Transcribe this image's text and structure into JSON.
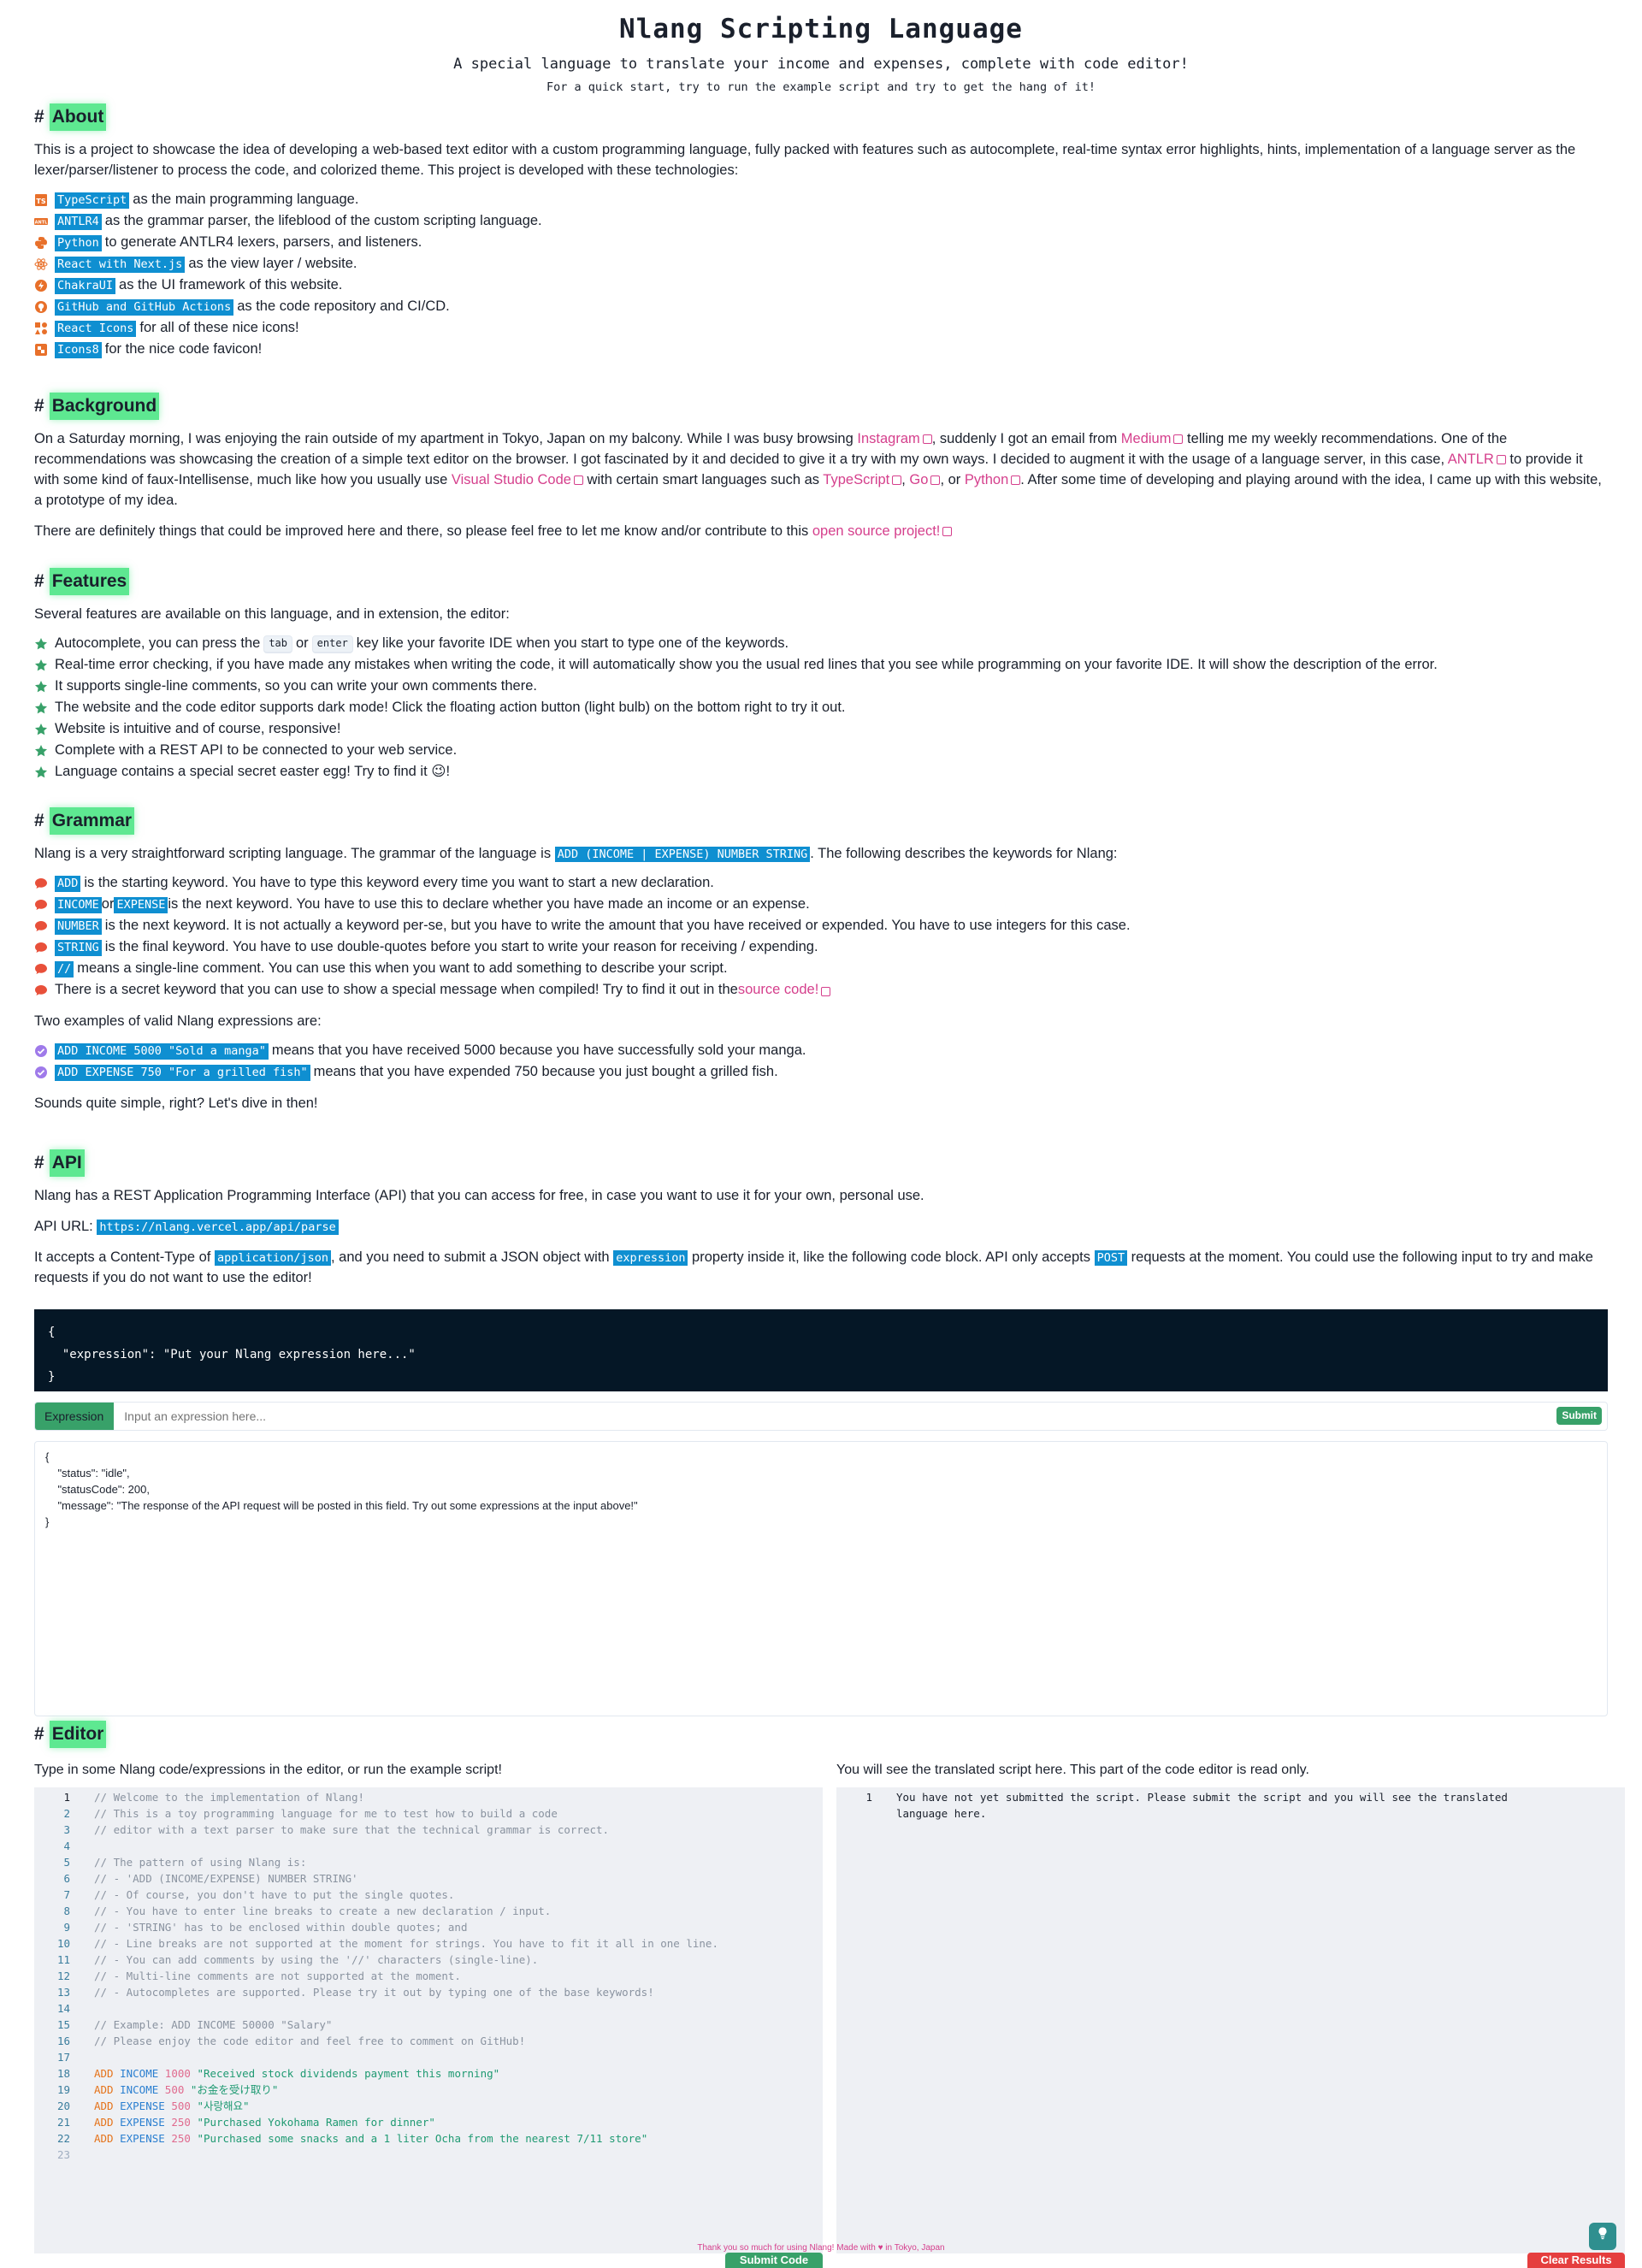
{
  "header": {
    "title": "Nlang Scripting Language",
    "subtitle": "A special language to translate your income and expenses, complete with code editor!",
    "hint": "For a quick start, try to run the example script and try to get the hang of it!"
  },
  "about": {
    "heading": "About",
    "intro": "This is a project to showcase the idea of developing a web-based text editor with a custom programming language, fully packed with features such as autocomplete, real-time syntax error highlights, hints, implementation of a language server as the lexer/parser/listener to process the code, and colorized theme. This project is developed with these technologies:",
    "tech": [
      {
        "icon": "typescript-icon",
        "tag": "TypeScript",
        "text": " as the main programming language."
      },
      {
        "icon": "antlr-icon",
        "tag": "ANTLR4",
        "text": " as the grammar parser, the lifeblood of the custom scripting language."
      },
      {
        "icon": "python-icon",
        "tag": "Python",
        "text": " to generate ANTLR4 lexers, parsers, and listeners."
      },
      {
        "icon": "react-icon",
        "tag": "React with Next.js",
        "text": " as the view layer / website."
      },
      {
        "icon": "chakra-icon",
        "tag": "ChakraUI",
        "text": " as the UI framework of this website."
      },
      {
        "icon": "github-icon",
        "tag": "GitHub and GitHub Actions",
        "text": " as the code repository and CI/CD."
      },
      {
        "icon": "react-icons-icon",
        "tag": "React Icons",
        "text": " for all of these nice icons!"
      },
      {
        "icon": "icons8-icon",
        "tag": "Icons8",
        "text": " for the nice code favicon!"
      }
    ]
  },
  "background": {
    "heading": "Background",
    "p1": {
      "a": "On a Saturday morning, I was enjoying the rain outside of my apartment in Tokyo, Japan on my balcony. While I was busy browsing ",
      "l1": "Instagram",
      "b": ", suddenly I got an email from ",
      "l2": "Medium",
      "c": " telling me my weekly recommendations. One of the recommendations was showcasing the creation of a simple text editor on the browser. I got fascinated by it and decided to give it a try with my own ways. I decided to augment it with the usage of a language server, in this case, ",
      "l3": "ANTLR",
      "d": " to provide it with some kind of faux-Intellisense, much like how you usually use ",
      "l4": "Visual Studio Code",
      "e": " with certain smart languages such as ",
      "l5": "TypeScript",
      "f": ", ",
      "l6": "Go",
      "g": ", or ",
      "l7": "Python",
      "h": ". After some time of developing and playing around with the idea, I came up with this website, a prototype of my idea."
    },
    "p2": "There are definitely things that could be improved here and there, so please feel free to let me know and/or contribute to this ",
    "p2_link": "open source project!"
  },
  "features": {
    "heading": "Features",
    "intro": "Several features are available on this language, and in extension, the editor:",
    "f1_a": "Autocomplete, you can press the ",
    "f1_k1": "tab",
    "f1_b": " or ",
    "f1_k2": "enter",
    "f1_c": " key like your favorite IDE when you start to type one of the keywords.",
    "items": [
      "Real-time error checking, if you have made any mistakes when writing the code, it will automatically show you the usual red lines that you see while programming on your favorite IDE. It will show the description of the error.",
      "It supports single-line comments, so you can write your own comments there.",
      "The website and the code editor supports dark mode! Click the floating action button (light bulb) on the bottom right to try it out.",
      "Website is intuitive and of course, responsive!",
      "Complete with a REST API to be connected to your web service.",
      "Language contains a special secret easter egg! Try to find it 😉!"
    ]
  },
  "grammar": {
    "heading": "Grammar",
    "intro_a": "Nlang is a very straightforward scripting language. The grammar of the language is ",
    "intro_tag": "ADD (INCOME | EXPENSE) NUMBER STRING",
    "intro_b": ". The following describes the keywords for Nlang:",
    "k_add": "ADD",
    "k_add_t": " is the starting keyword. You have to type this keyword every time you want to start a new declaration.",
    "k_income": "INCOME",
    "k_or": " or ",
    "k_expense": "EXPENSE",
    "k_ie_t": " is the next keyword. You have to use this to declare whether you have made an income or an expense.",
    "k_number": "NUMBER",
    "k_number_t": " is the next keyword. It is not actually a keyword per-se, but you have to write the amount that you have received or expended. You have to use integers for this case.",
    "k_string": "STRING",
    "k_string_t": " is the final keyword. You have to use double-quotes before you start to write your reason for receiving / expending.",
    "k_comment": "//",
    "k_comment_t": " means a single-line comment. You can use this when you want to add something to describe your script.",
    "k_secret_t": "There is a secret keyword that you can use to show a special message when compiled! Try to find it out in the ",
    "k_secret_link": "source code!",
    "examples_intro": "Two examples of valid Nlang expressions are:",
    "ex1_tag": "ADD INCOME 5000 \"Sold a manga\"",
    "ex1_t": " means that you have received 5000 because you have successfully sold your manga.",
    "ex2_tag": "ADD EXPENSE 750 \"For a grilled fish\"",
    "ex2_t": " means that you have expended 750 because you just bought a grilled fish.",
    "outro": "Sounds quite simple, right? Let's dive in then!"
  },
  "api": {
    "heading": "API",
    "intro": "Nlang has a REST Application Programming Interface (API) that you can access for free, in case you want to use it for your own, personal use.",
    "url_label": "API URL: ",
    "url": "https://nlang.vercel.app/api/parse",
    "p_a": "It accepts a Content-Type of ",
    "p_tag1": "application/json",
    "p_b": ", and you need to submit a JSON object with ",
    "p_tag2": "expression",
    "p_c": " property inside it, like the following code block. API only accepts ",
    "p_tag3": "POST",
    "p_d": " requests at the moment. You could use the following input to try and make requests if you do not want to use the editor!",
    "code_l1": "{",
    "code_l2": "  \"expression\": \"Put your Nlang expression here...\"",
    "code_l3": "}",
    "expr_label": "Expression",
    "expr_placeholder": "Input an expression here...",
    "submit": "Submit",
    "response": "{\n    \"status\": \"idle\",\n    \"statusCode\": 200,\n    \"message\": \"The response of the API request will be posted in this field. Try out some expressions at the input above!\"\n}"
  },
  "editor": {
    "heading": "Editor",
    "left_caption": "Type in some Nlang code/expressions in the editor, or run the example script!",
    "right_caption": "You will see the translated script here. This part of the code editor is read only.",
    "code_lines": [
      {
        "n": "1",
        "t": "// Welcome to the implementation of Nlang!"
      },
      {
        "n": "2",
        "t": "// This is a toy programming language for me to test how to build a code"
      },
      {
        "n": "3",
        "t": "// editor with a text parser to make sure that the technical grammar is correct."
      },
      {
        "n": "4",
        "t": ""
      },
      {
        "n": "5",
        "t": "// The pattern of using Nlang is:"
      },
      {
        "n": "6",
        "t": "// - 'ADD (INCOME/EXPENSE) NUMBER STRING'"
      },
      {
        "n": "7",
        "t": "// - Of course, you don't have to put the single quotes."
      },
      {
        "n": "8",
        "t": "// - You have to enter line breaks to create a new declaration / input."
      },
      {
        "n": "9",
        "t": "// - 'STRING' has to be enclosed within double quotes; and"
      },
      {
        "n": "10",
        "t": "// - Line breaks are not supported at the moment for strings. You have to fit it all in one line."
      },
      {
        "n": "11",
        "t": "// - You can add comments by using the '//' characters (single-line)."
      },
      {
        "n": "12",
        "t": "// - Multi-line comments are not supported at the moment."
      },
      {
        "n": "13",
        "t": "// - Autocompletes are supported. Please try it out by typing one of the base keywords!"
      },
      {
        "n": "14",
        "t": ""
      },
      {
        "n": "15",
        "t": "// Example: ADD INCOME 50000 \"Salary\""
      },
      {
        "n": "16",
        "t": "// Please enjoy the code editor and feel free to comment on GitHub!"
      },
      {
        "n": "17",
        "t": ""
      }
    ],
    "stmts": [
      {
        "n": "18",
        "add": "ADD",
        "type": "INCOME",
        "num": "1000",
        "str": "\"Received stock dividends payment this morning\""
      },
      {
        "n": "19",
        "add": "ADD",
        "type": "INCOME",
        "num": "500",
        "str": "\"お金を受け取り\""
      },
      {
        "n": "20",
        "add": "ADD",
        "type": "EXPENSE",
        "num": "500",
        "str": "\"사랑해요\""
      },
      {
        "n": "21",
        "add": "ADD",
        "type": "EXPENSE",
        "num": "250",
        "str": "\"Purchased Yokohama Ramen for dinner\""
      },
      {
        "n": "22",
        "add": "ADD",
        "type": "EXPENSE",
        "num": "250",
        "str": "\"Purchased some snacks and a 1 liter Ocha from the nearest 7/11 store\""
      }
    ],
    "last_line": "23",
    "output_line_no": "1",
    "output_l1": "You have not yet submitted the script. Please submit the script and you will see the translated",
    "output_l2": "language here."
  },
  "footer": {
    "note": "Thank you so much for using Nlang! Made with ♥ in Tokyo, Japan",
    "submit_code": "Submit Code",
    "clear_results": "Clear Results"
  },
  "colors": {
    "accent_green": "#38a169",
    "heading_highlight": "#5ee891",
    "tag_blue": "#0f8fd1",
    "link_pink": "#d53f8c",
    "danger_red": "#e53e3e",
    "code_bg": "#051726"
  }
}
